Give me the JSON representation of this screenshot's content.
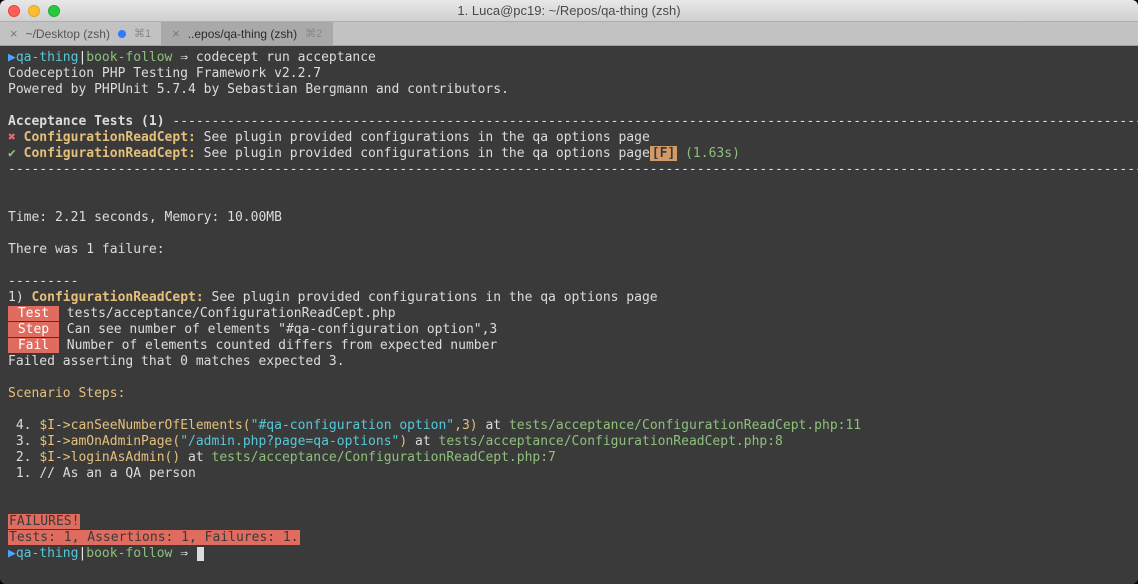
{
  "window": {
    "title": "1. Luca@pc19: ~/Repos/qa-thing (zsh)"
  },
  "tabs": [
    {
      "close": "×",
      "label": "~/Desktop (zsh)",
      "kbd": "⌘1",
      "hasDot": true,
      "active": false
    },
    {
      "close": "×",
      "label": "..epos/qa-thing (zsh)",
      "kbd": "⌘2",
      "hasDot": false,
      "active": true
    }
  ],
  "prompt": {
    "caret": "▶",
    "repo": "qa-thing",
    "sep": "|",
    "branch": "book-follow",
    "arrow": "⇒",
    "cmd": " codecept run acceptance"
  },
  "header": {
    "line1": "Codeception PHP Testing Framework v2.2.7",
    "line2": "Powered by PHPUnit 5.7.4 by Sebastian Bergmann and contributors."
  },
  "section": {
    "title": "Acceptance Tests (1) ",
    "rule": "-------------------------------------------------------------------------------------------------------------------------------------"
  },
  "tests": [
    {
      "mark": "✖",
      "markClass": "c-red",
      "name": "ConfigurationReadCept:",
      "desc": " See plugin provided configurations in the qa options page",
      "badge": "",
      "time": ""
    },
    {
      "mark": "✔",
      "markClass": "c-green",
      "name": "ConfigurationReadCept:",
      "desc": " See plugin provided configurations in the qa options page",
      "badge": "[F]",
      "time": " (1.63s)"
    }
  ],
  "rule2": "-----------------------------------------------------------------------------------------------------------------------------------------------------------",
  "timing": "Time: 2.21 seconds, Memory: 10.00MB",
  "failLine": "There was 1 failure:",
  "dashes": "---------",
  "fail": {
    "num": "1) ",
    "name": "ConfigurationReadCept:",
    "desc": " See plugin provided configurations in the qa options page",
    "labels": {
      "test": " Test ",
      "step": " Step ",
      "fail": " Fail "
    },
    "testPath": " tests/acceptance/ConfigurationReadCept.php",
    "stepText": " Can see number of elements \"#qa-configuration option\",3",
    "failText": " Number of elements counted differs from expected number",
    "assert": "Failed asserting that 0 matches expected 3."
  },
  "scenario": {
    "title": "Scenario Steps:",
    "steps": [
      {
        "n": " 4. ",
        "codeA": "$I->canSeeNumberOfElements(",
        "lit": "\"#qa-configuration option\"",
        "codeB": ",3)",
        "at": " at ",
        "loc": "tests/acceptance/ConfigurationReadCept.php:11"
      },
      {
        "n": " 3. ",
        "codeA": "$I->amOnAdminPage(",
        "lit": "\"/admin.php?page=qa-options\"",
        "codeB": ")",
        "at": " at ",
        "loc": "tests/acceptance/ConfigurationReadCept.php:8"
      },
      {
        "n": " 2. ",
        "codeA": "$I->loginAsAdmin()",
        "lit": "",
        "codeB": "",
        "at": " at ",
        "loc": "tests/acceptance/ConfigurationReadCept.php:7"
      },
      {
        "n": " 1. ",
        "codeA": "// As an a QA person",
        "lit": "",
        "codeB": "",
        "at": "",
        "loc": ""
      }
    ]
  },
  "summary": {
    "failures": "FAILURES!",
    "counts": "Tests: 1, Assertions: 1, Failures: 1."
  }
}
